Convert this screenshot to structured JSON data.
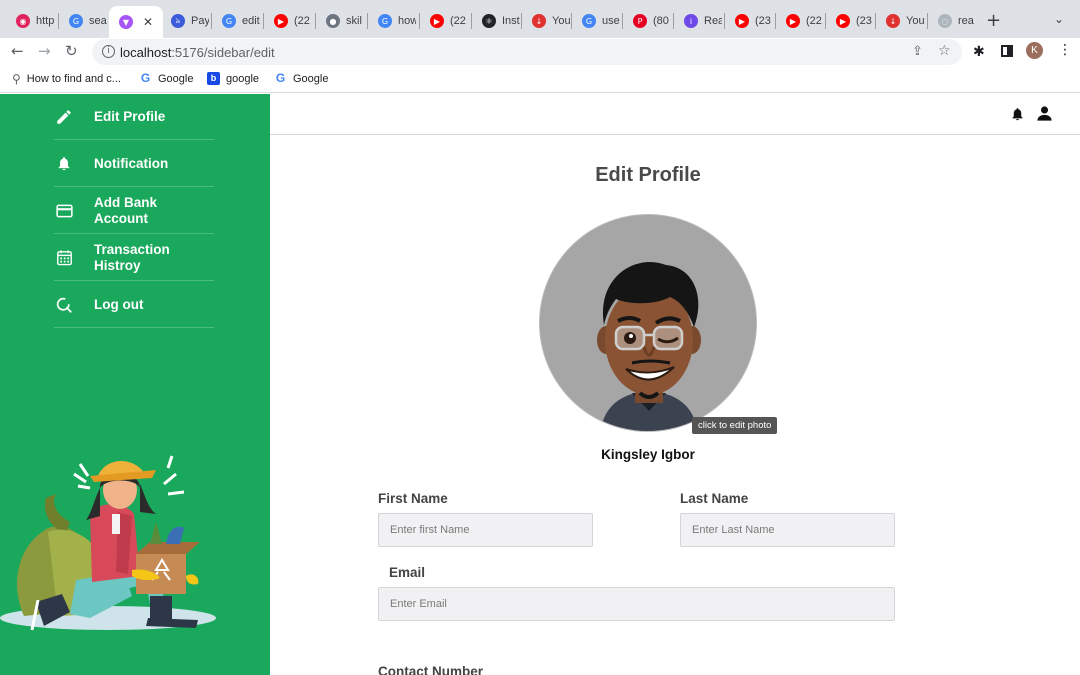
{
  "browser": {
    "tabs": [
      {
        "label": "http",
        "color": "#e0245e",
        "glyph": "◉"
      },
      {
        "label": "sea",
        "color": "#4285f4",
        "glyph": "G"
      },
      {
        "label": "",
        "color": "#a855f7",
        "glyph": "▼",
        "active": true
      },
      {
        "label": "Pay",
        "color": "#3b5bdb",
        "glyph": "৯"
      },
      {
        "label": "edit",
        "color": "#4285f4",
        "glyph": "G"
      },
      {
        "label": "(22",
        "color": "#ff0000",
        "glyph": "▶"
      },
      {
        "label": "skil",
        "color": "#6e7681",
        "glyph": "●"
      },
      {
        "label": "how",
        "color": "#4285f4",
        "glyph": "G"
      },
      {
        "label": "(22",
        "color": "#ff0000",
        "glyph": "▶"
      },
      {
        "label": "Inst",
        "color": "#20232a",
        "glyph": "⚛"
      },
      {
        "label": "You",
        "color": "#e03131",
        "glyph": "↓"
      },
      {
        "label": "use",
        "color": "#4285f4",
        "glyph": "G"
      },
      {
        "label": "(80",
        "color": "#e60023",
        "glyph": "P"
      },
      {
        "label": "Rea",
        "color": "#7048e8",
        "glyph": "i"
      },
      {
        "label": "(23",
        "color": "#ff0000",
        "glyph": "▶"
      },
      {
        "label": "(22",
        "color": "#ff0000",
        "glyph": "▶"
      },
      {
        "label": "(23",
        "color": "#ff0000",
        "glyph": "▶"
      },
      {
        "label": "You",
        "color": "#e03131",
        "glyph": "↓"
      },
      {
        "label": "rea",
        "color": "#adb5bd",
        "glyph": "◌"
      }
    ],
    "url_host": "localhost",
    "url_path": ":5176/sidebar/edit",
    "profile_initial": "K",
    "bookmarks": [
      {
        "label": "How to find and c...",
        "icon": "search-icon"
      },
      {
        "label": "Google",
        "icon": "google-icon"
      },
      {
        "label": "google",
        "icon": "bing-icon"
      },
      {
        "label": "Google",
        "icon": "google-icon"
      }
    ]
  },
  "sidebar": {
    "color": "#19a85c",
    "items": [
      {
        "label": "Edit Profile",
        "icon": "pencil-icon"
      },
      {
        "label": "Notification",
        "icon": "bell-icon"
      },
      {
        "label": "Add Bank Account",
        "icon": "credit-card-icon"
      },
      {
        "label": "Transaction Histroy",
        "icon": "calendar-icon"
      },
      {
        "label": "Log out",
        "icon": "logout-icon"
      }
    ]
  },
  "main": {
    "title": "Edit Profile",
    "photo_tooltip": "click to edit photo",
    "profile_name": "Kingsley Igbor",
    "fields": {
      "first_name_label": "First Name",
      "first_name_placeholder": "Enter first Name",
      "last_name_label": "Last Name",
      "last_name_placeholder": "Enter Last Name",
      "email_label": "Email",
      "email_placeholder": "Enter Email",
      "contact_label": "Contact Number"
    }
  }
}
